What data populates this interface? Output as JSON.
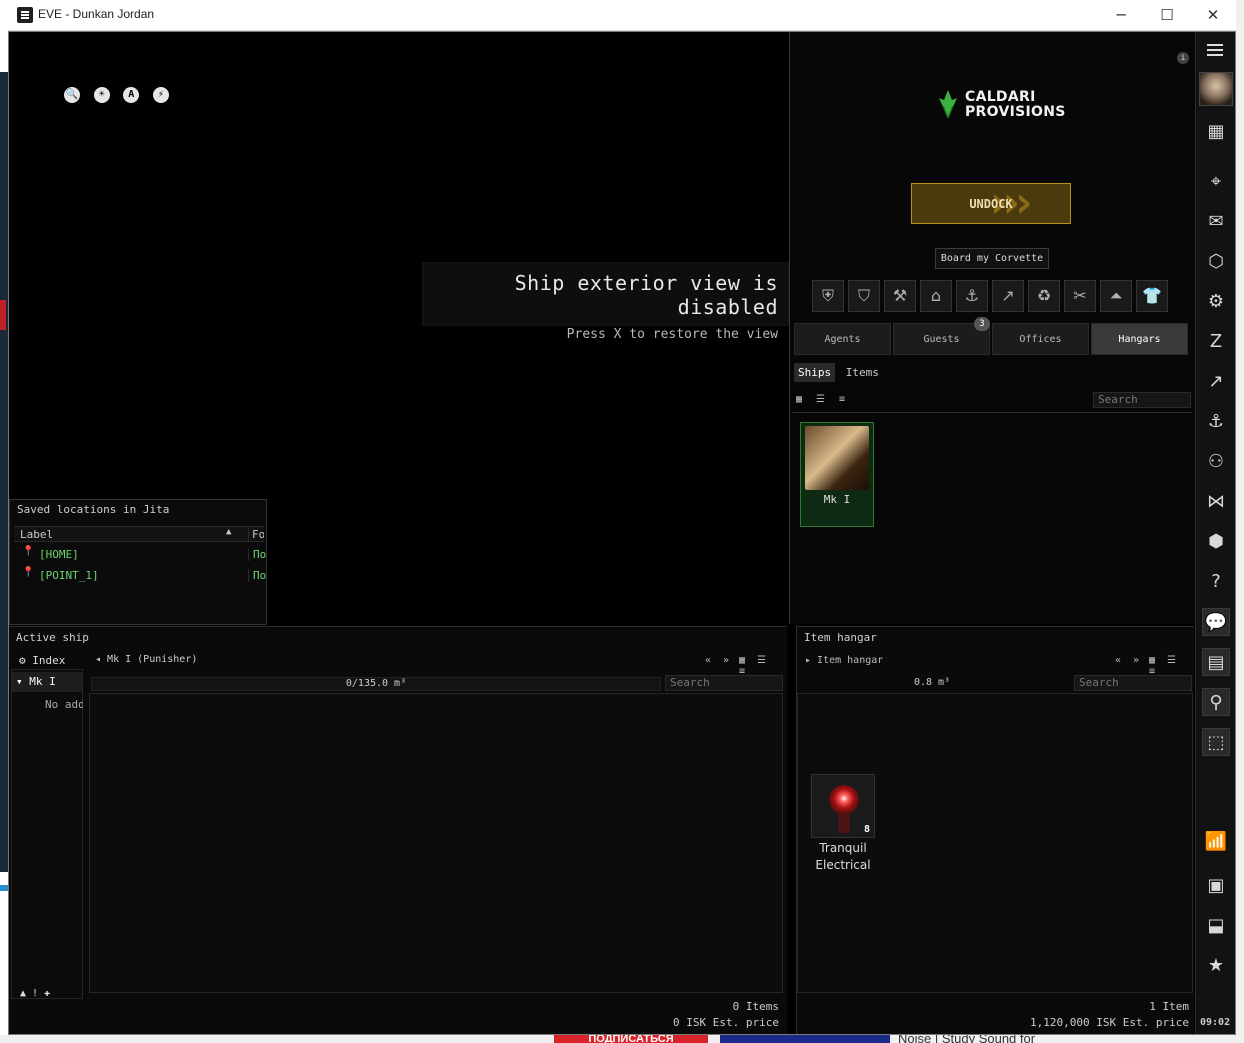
{
  "window": {
    "title": "EVE - Dunkan Jordan",
    "minimize_label": "─",
    "maximize_label": "☐",
    "close_label": "✕"
  },
  "view": {
    "tools": [
      "🔍",
      "☀",
      "A",
      "⚡"
    ],
    "exterior_title": "Ship exterior view is disabled",
    "exterior_hint": "Press X to restore the view"
  },
  "saved_locations": {
    "title": "Saved locations in Jita",
    "col_label": "Label",
    "col_folder": "Fol",
    "sort_arrow": "▲",
    "rows": [
      {
        "label": "[HOME]",
        "folder": "По"
      },
      {
        "label": "[POINT_1]",
        "folder": "По"
      }
    ]
  },
  "station": {
    "info": "i",
    "logo_line1": "CALDARI",
    "logo_line2": "PROVISIONS",
    "undock_label": "UNDOCK",
    "board_label": "Board my Corvette",
    "services": [
      "⛨",
      "⛉",
      "⚒",
      "⌂",
      "⚓",
      "↗",
      "♻",
      "✂",
      "⏶",
      "👕"
    ],
    "tabs": [
      {
        "label": "Agents"
      },
      {
        "label": "Guests"
      },
      {
        "label": "Offices"
      },
      {
        "label": "Hangars"
      }
    ],
    "guests_badge": "3",
    "subtabs": [
      "Ships",
      "Items"
    ],
    "view_icons": "▦ ☰ ≡",
    "search_placeholder": "Search",
    "ships": [
      {
        "name": "Mk I"
      }
    ]
  },
  "active_ship": {
    "title": "Active ship",
    "index_label": "Index",
    "tree_item": "Mk I",
    "no_add": "No add",
    "crumb": "Mk I (Punisher)",
    "nav": "« »",
    "view_icons": "▦ ☰ ≡",
    "capacity": "0/135.0 m³",
    "search_placeholder": "Search",
    "items_count": "0 Items",
    "est_price": "0 ISK Est. price",
    "bottom_tools": "▲ ! ✚"
  },
  "item_hangar": {
    "title": "Item hangar",
    "crumb": "Item hangar",
    "nav": "« »",
    "view_icons": "▦ ☰ ≡",
    "capacity": "0.8 m³",
    "search_placeholder": "Search",
    "item_name_1": "Tranquil",
    "item_name_2": "Electrical",
    "item_qty": "8",
    "items_count": "1 Item",
    "est_price": "1,120,000 ISK Est. price"
  },
  "neocom": {
    "clock": "09:02",
    "icons": [
      "▦",
      "⌖",
      "✉",
      "⬡",
      "⚙",
      "Z",
      "↗",
      "⚓",
      "⚇",
      "⋈",
      "⬢",
      "?",
      "💬",
      "▤",
      "⚲",
      "⬚",
      "📶",
      "▣",
      "⬓",
      "★"
    ]
  },
  "desktop": {
    "subscribe": "ПОДПИСАТЬСЯ",
    "video_title": "Noise | Study Sound for"
  }
}
